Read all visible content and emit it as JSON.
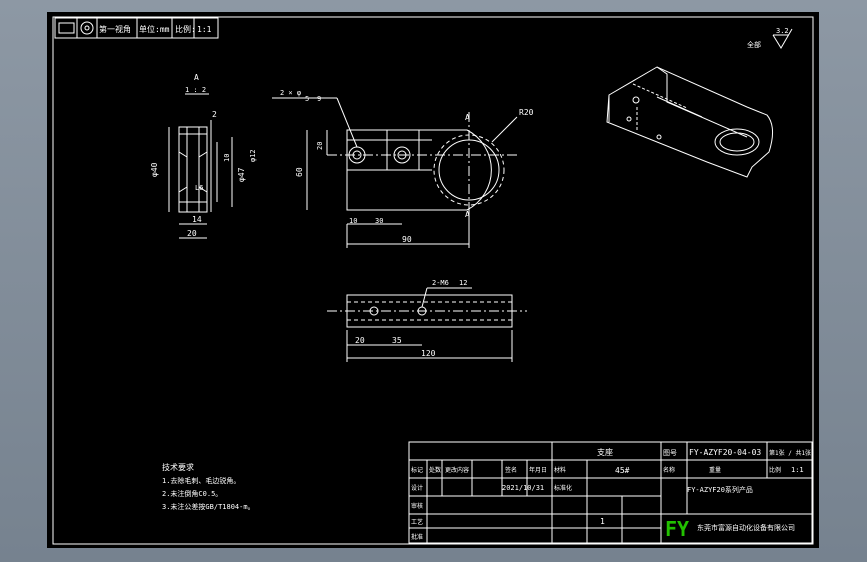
{
  "header_block": {
    "item1": "第一视角",
    "item2": "单位:mm",
    "item3": "比例:",
    "item4": "1:1"
  },
  "roughness": {
    "prefix": "全部",
    "value": "3.2"
  },
  "section_view": {
    "label": "A",
    "sublabel": "1 : 2",
    "dims": [
      "2",
      "φ40",
      "φ47",
      "10",
      "φ12",
      "L6",
      "14",
      "20"
    ]
  },
  "front_view": {
    "hole_callout_1": "2 × φ",
    "hole_callout_2": "5",
    "hole_callout_3": "9",
    "radius": "R20",
    "section_mark_top": "A",
    "section_mark_bottom": "A",
    "dims": [
      "20",
      "60",
      "10",
      "30",
      "90"
    ]
  },
  "bottom_view": {
    "thread_callout": "2-M6",
    "thread_depth": "12",
    "dims": [
      "20",
      "35",
      "120"
    ]
  },
  "tech_notes": {
    "title": "技术要求",
    "lines": [
      "1.去除毛刺、毛边锐角。",
      "2.未注倒角C0.5。",
      "3.未注公差按GB/T1804-m。"
    ]
  },
  "title_block": {
    "part_name_cn": "支座",
    "drawing_no": "FY-AZYF20-04-03",
    "sheet_info": "第1张 / 共1张",
    "material": "45#",
    "date": "2021/10/31",
    "scale_label": "比例",
    "scale_value": "1:1",
    "project": "FY-AZYF20系列产品",
    "quantity": "1",
    "logo": "FY",
    "company": "东莞市富源自动化设备有限公司",
    "row_labels": [
      "标记",
      "处数",
      "更改内容",
      "签名",
      "年月日",
      "设计",
      "审核",
      "工艺",
      "批准",
      "标准化"
    ],
    "misc": [
      "材料",
      "重量",
      "图号",
      "名称"
    ]
  },
  "colors": {
    "line": "#ffffff",
    "accent": "#22c000",
    "paper": "#000000"
  }
}
